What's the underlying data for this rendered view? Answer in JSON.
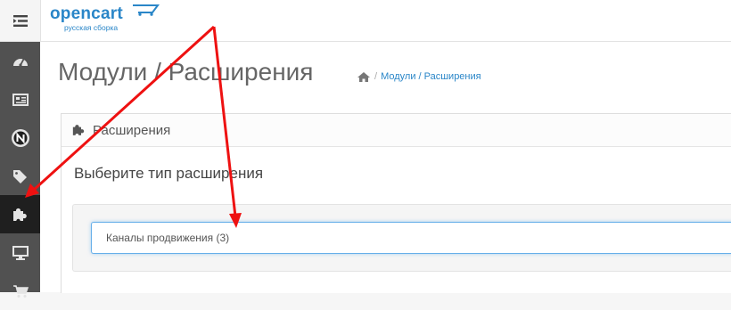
{
  "header": {
    "logo_text": "opencart",
    "logo_subtext": "русская сборка",
    "menu_toggle_icon": "menu-toggle-icon"
  },
  "sidebar": {
    "items": [
      {
        "icon": "dashboard-icon",
        "active": false
      },
      {
        "icon": "catalog-icon",
        "active": false
      },
      {
        "icon": "neoseo-icon",
        "active": false
      },
      {
        "icon": "tags-icon",
        "active": false
      },
      {
        "icon": "puzzle-icon",
        "active": true
      },
      {
        "icon": "desktop-icon",
        "active": false
      },
      {
        "icon": "cart-icon",
        "active": false
      }
    ]
  },
  "page": {
    "title": "Модули / Расширения",
    "breadcrumb": {
      "home_icon": "home-icon",
      "separator": "/",
      "current": "Модули / Расширения"
    }
  },
  "panel": {
    "heading": "Расширения",
    "heading_icon": "puzzle-icon",
    "subtitle": "Выберите тип расширения",
    "select_value": "Каналы продвижения (3)"
  },
  "colors": {
    "brand": "#2a86c8",
    "sidebar_bg": "#515151",
    "sidebar_active": "#1f1f1f",
    "annotation_arrow": "#ee1111"
  }
}
